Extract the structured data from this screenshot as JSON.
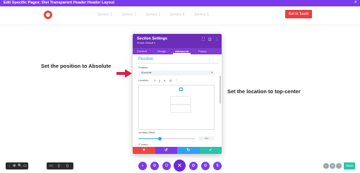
{
  "topbar": {
    "title": "Edit Specific Pages: Divi Transparent Header Header Layout",
    "close_icon": "×"
  },
  "site_header": {
    "nav_items": [
      "Service 1",
      "Service 2",
      "Service 3",
      "Service 4",
      "Service 5"
    ],
    "cta_label": "Get In Touch"
  },
  "annotations": {
    "left": "Set the position to Absolute",
    "right": "Set the location to top-center"
  },
  "modal": {
    "title": "Section Settings",
    "subtitle": "Preset: Default ▾",
    "header_icons": [
      "⛶",
      "◫",
      "⋮"
    ],
    "tabs": [
      "Content",
      "Design",
      "Advanced",
      "Popup"
    ],
    "active_tab": "Advanced",
    "section": {
      "title": "Position",
      "icons": "⌃ ⋮"
    },
    "position_label": "Position",
    "position_value": "Absolute",
    "location_label": "Location",
    "location_icons": [
      "?",
      "▯",
      "↖",
      "↺",
      "⋮"
    ],
    "vertical_offset_label": "Vertical Offset",
    "vertical_offset_value": "0px",
    "z_index_label": "Z Index",
    "footer": [
      {
        "icon": "✕",
        "color": "#ef4444"
      },
      {
        "icon": "↺",
        "color": "#7c3aed"
      },
      {
        "icon": "↻",
        "color": "#2ea3f2"
      },
      {
        "icon": "✓",
        "color": "#29c4a9"
      }
    ]
  },
  "bottom_bar": {
    "left_icons": [
      "⋮",
      "⚙",
      "🔍",
      "▭"
    ],
    "view_icons": [
      "▭",
      "▯",
      "▯"
    ],
    "center_buttons": [
      "+",
      "⚙",
      "⏻",
      "✕",
      "⚙",
      "⚙",
      "⇅"
    ],
    "right_circles": [
      "◐",
      "⊕",
      "?"
    ],
    "save_label": "Save"
  },
  "colors": {
    "primary": "#7c3aed",
    "accent_blue": "#2ea3f2",
    "annotation_red": "#e11d48",
    "cta_red": "#e8413f"
  }
}
